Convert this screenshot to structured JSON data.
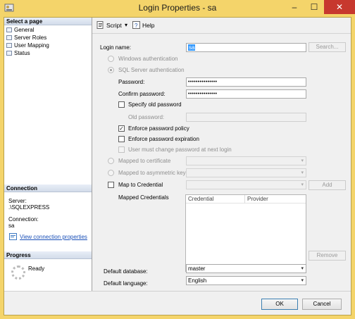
{
  "window": {
    "title": "Login Properties - sa",
    "minimize": "–",
    "maximize": "☐",
    "close": "✕"
  },
  "left": {
    "select_page_header": "Select a page",
    "pages": [
      {
        "label": "General"
      },
      {
        "label": "Server Roles"
      },
      {
        "label": "User Mapping"
      },
      {
        "label": "Status"
      }
    ],
    "connection_header": "Connection",
    "server_label": "Server:",
    "server_value": ".\\SQLEXPRESS",
    "connection_label": "Connection:",
    "connection_value": "sa",
    "view_link": "View connection properties",
    "progress_header": "Progress",
    "progress_status": "Ready"
  },
  "toolbar": {
    "script_label": "Script",
    "script_arrow": "▾",
    "help_label": "Help"
  },
  "form": {
    "login_name_label": "Login name:",
    "login_name_value": "sa",
    "search_button": "Search...",
    "windows_auth": "Windows authentication",
    "sql_auth": "SQL Server authentication",
    "password_label": "Password:",
    "password_value": "•••••••••••••••",
    "confirm_label": "Confirm password:",
    "confirm_value": "•••••••••••••••",
    "specify_old": "Specify old password",
    "old_password_label": "Old password:",
    "enforce_policy": "Enforce password policy",
    "enforce_expiration": "Enforce password expiration",
    "must_change": "User must change password at next login",
    "mapped_cert": "Mapped to certificate",
    "mapped_asym": "Mapped to asymmetric key",
    "map_credential": "Map to Credential",
    "add_button": "Add",
    "mapped_credentials_label": "Mapped Credentials",
    "grid_headers": [
      "Credential",
      "Provider"
    ],
    "remove_button": "Remove",
    "default_db_label": "Default database:",
    "default_db_value": "master",
    "default_lang_label": "Default language:",
    "default_lang_value": "English",
    "check_mark": "✓",
    "combo_arrow": "▾"
  },
  "buttons": {
    "ok": "OK",
    "cancel": "Cancel"
  }
}
